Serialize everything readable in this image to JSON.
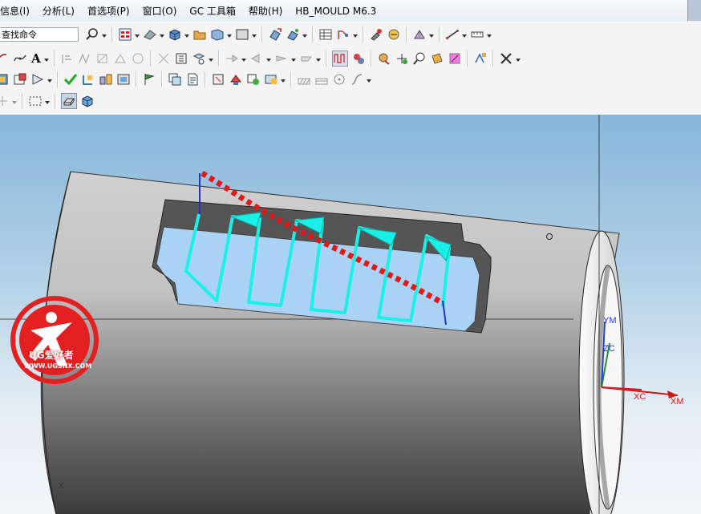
{
  "menu": {
    "items": [
      "信息(I)",
      "分析(L)",
      "首选项(P)",
      "窗口(O)",
      "GC 工具箱",
      "帮助(H)",
      "HB_MOULD M6.3"
    ]
  },
  "toolbar": {
    "command_finder_value": "查找命令",
    "text_tool_label": "A"
  },
  "viewport": {
    "background_top": "#86b6da",
    "background_bottom": "#f3f6f9",
    "part_color": "#8c8c8c",
    "pocket_color": "#a9d2f5",
    "toolpath_color": "#19f0e8",
    "guide_color": "#e01818",
    "axis_labels": {
      "ym": "YM",
      "zc": "ZC",
      "xc": "XC",
      "xm": "XM",
      "x_small": "X"
    }
  },
  "watermark": {
    "text": "UG爱好者",
    "url": "WWW.UGSNX.COM"
  },
  "icons": [
    "search-icon",
    "layer-icon",
    "shade-icon",
    "box-icon",
    "folder-icon",
    "view-icon",
    "square-icon",
    "move-icon",
    "snap-icon",
    "table-icon",
    "measure-icon",
    "tool-icon",
    "analysis-icon",
    "ruler-icon",
    "arc-icon",
    "spline-icon",
    "text-icon",
    "check-icon",
    "close-icon",
    "wireframe-icon",
    "shaded-icon"
  ]
}
